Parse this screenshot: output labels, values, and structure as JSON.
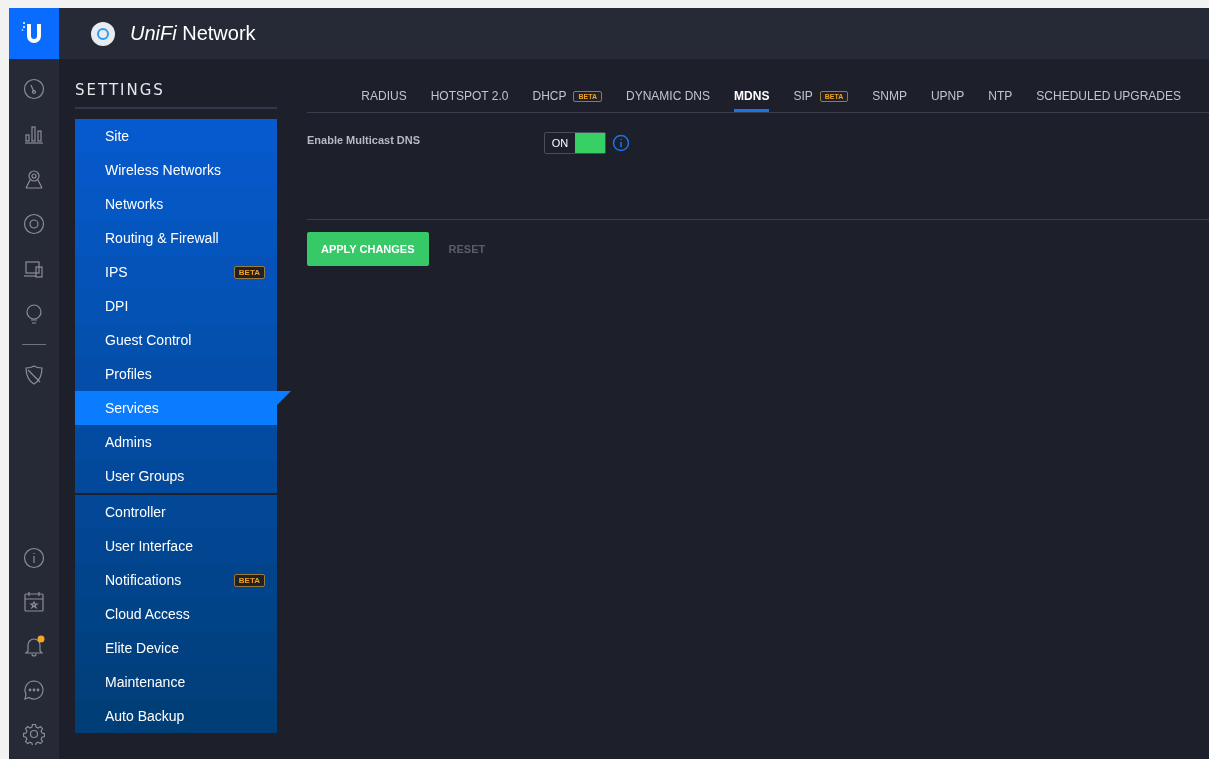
{
  "header": {
    "app_title": "*UniFi* Network"
  },
  "settings": {
    "title": "SETTINGS",
    "groups": [
      {
        "items": [
          {
            "label": "Site",
            "selected": false
          },
          {
            "label": "Wireless Networks",
            "selected": false
          },
          {
            "label": "Networks",
            "selected": false
          },
          {
            "label": "Routing & Firewall",
            "selected": false
          },
          {
            "label": "IPS",
            "selected": false,
            "badge": "BETA"
          },
          {
            "label": "DPI",
            "selected": false
          },
          {
            "label": "Guest Control",
            "selected": false
          },
          {
            "label": "Profiles",
            "selected": false
          },
          {
            "label": "Services",
            "selected": true
          },
          {
            "label": "Admins",
            "selected": false
          },
          {
            "label": "User Groups",
            "selected": false
          }
        ]
      },
      {
        "items": [
          {
            "label": "Controller",
            "selected": false
          },
          {
            "label": "User Interface",
            "selected": false
          },
          {
            "label": "Notifications",
            "selected": false,
            "badge": "BETA"
          },
          {
            "label": "Cloud Access",
            "selected": false
          },
          {
            "label": "Elite Device",
            "selected": false
          },
          {
            "label": "Maintenance",
            "selected": false
          },
          {
            "label": "Auto Backup",
            "selected": false
          }
        ]
      }
    ]
  },
  "tabs": [
    {
      "label": "RADIUS",
      "selected": false
    },
    {
      "label": "HOTSPOT 2.0",
      "selected": false
    },
    {
      "label": "DHCP",
      "selected": false,
      "badge": "BETA"
    },
    {
      "label": "DYNAMIC DNS",
      "selected": false
    },
    {
      "label": "MDNS",
      "selected": true
    },
    {
      "label": "SIP",
      "selected": false,
      "badge": "BETA"
    },
    {
      "label": "SNMP",
      "selected": false
    },
    {
      "label": "UPNP",
      "selected": false
    },
    {
      "label": "NTP",
      "selected": false
    },
    {
      "label": "SCHEDULED UPGRADES",
      "selected": false
    }
  ],
  "form": {
    "label": "Enable Multicast DNS",
    "toggle": {
      "on": true,
      "label": "ON"
    }
  },
  "buttons": [
    {
      "label": "APPLY CHANGES",
      "disabled": false
    },
    {
      "label": "RESET",
      "disabled": true
    }
  ]
}
